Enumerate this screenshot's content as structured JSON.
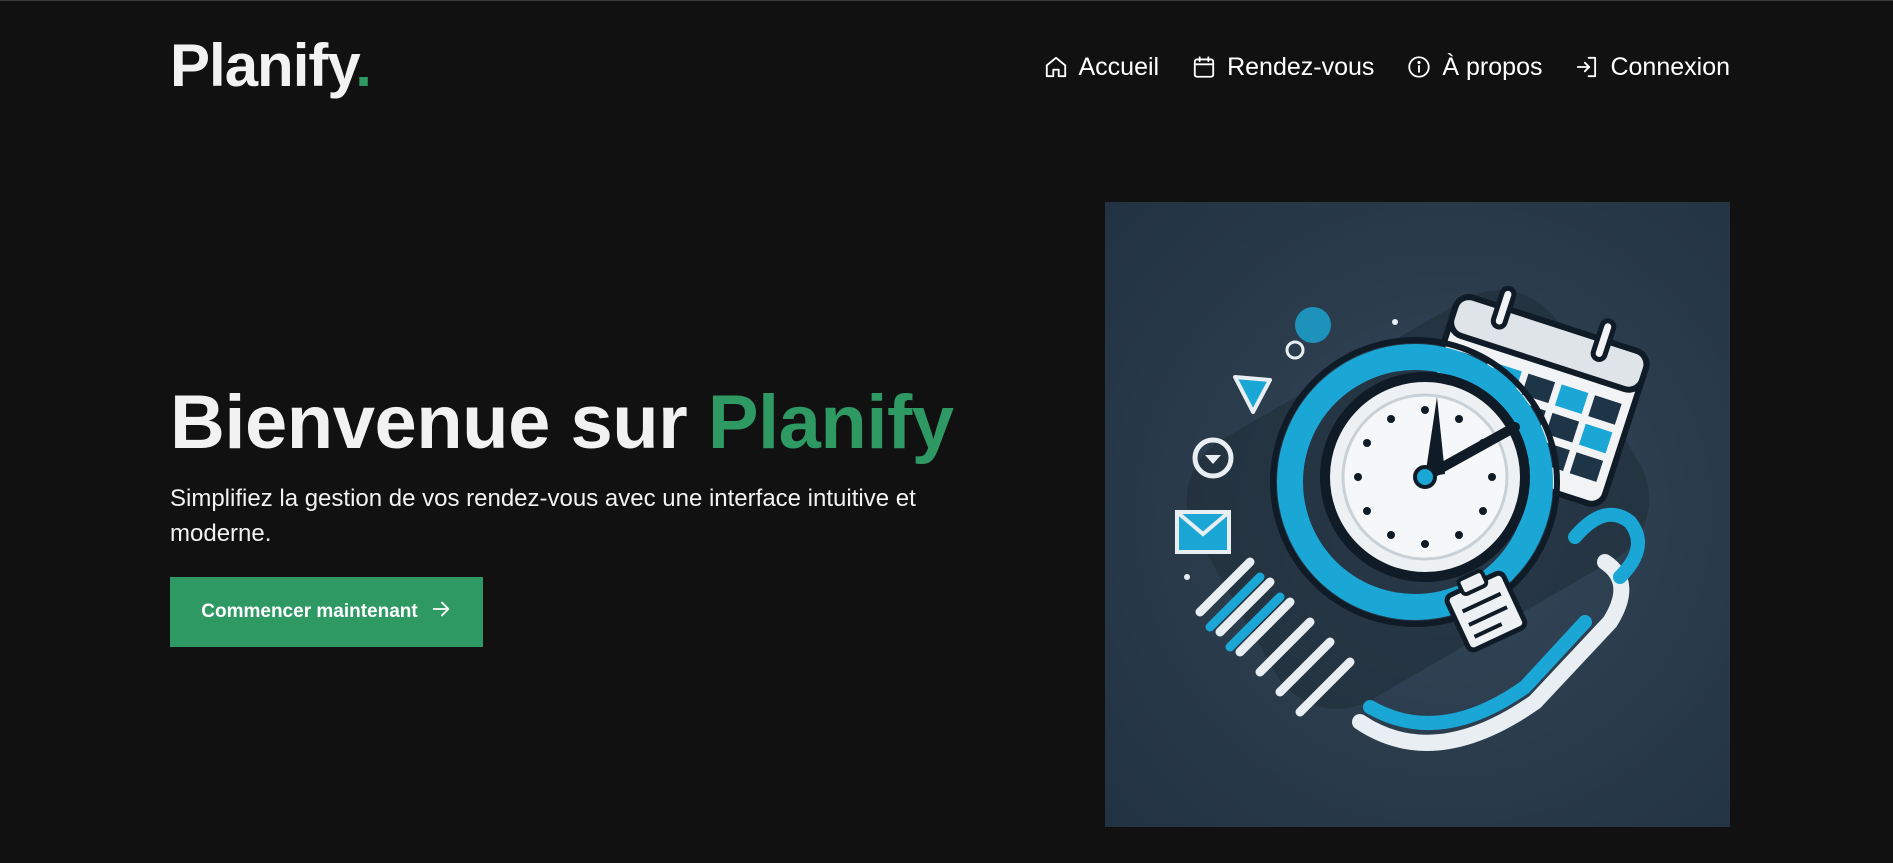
{
  "brand": {
    "name": "Planify",
    "dot": ".",
    "accent_color": "#2e9963"
  },
  "nav": {
    "items": [
      {
        "label": "Accueil",
        "icon": "home-icon"
      },
      {
        "label": "Rendez-vous",
        "icon": "calendar-icon"
      },
      {
        "label": "À propos",
        "icon": "info-icon"
      },
      {
        "label": "Connexion",
        "icon": "login-icon"
      }
    ]
  },
  "hero": {
    "title_prefix": "Bienvenue sur ",
    "title_accent": "Planify",
    "subtitle": "Simplifiez la gestion de vos rendez-vous avec une interface intuitive et moderne.",
    "cta_label": "Commencer maintenant",
    "cta_icon": "arrow-right-icon"
  },
  "illustration": {
    "icon": "clock-calendar-illustration"
  },
  "colors": {
    "background": "#111111",
    "text": "#f2f2f2",
    "accent": "#2e9963",
    "illustration_bg": "#2a3b4b",
    "illustration_blue": "#1aa7d6"
  }
}
